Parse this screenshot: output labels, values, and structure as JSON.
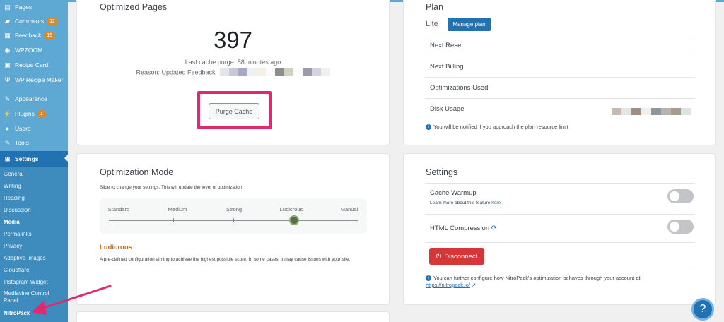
{
  "sidebar": {
    "items": [
      {
        "label": "Pages",
        "icon": "pages-icon",
        "glyph": "▤"
      },
      {
        "label": "Comments",
        "icon": "comments-icon",
        "glyph": "▰",
        "badge": "12"
      },
      {
        "label": "Feedback",
        "icon": "feedback-icon",
        "glyph": "▦",
        "badge": "15"
      },
      {
        "label": "WPZOOM",
        "icon": "wpzoom-icon",
        "glyph": "◉"
      },
      {
        "label": "Recipe Card",
        "icon": "recipe-card-icon",
        "glyph": "▣"
      },
      {
        "label": "WP Recipe Maker",
        "icon": "recipe-maker-icon",
        "glyph": "Ψ"
      },
      {
        "label": "Appearance",
        "icon": "appearance-icon",
        "glyph": "✎"
      },
      {
        "label": "Plugins",
        "icon": "plugins-icon",
        "glyph": "⚡",
        "badge": "1"
      },
      {
        "label": "Users",
        "icon": "users-icon",
        "glyph": "●"
      },
      {
        "label": "Tools",
        "icon": "tools-icon",
        "glyph": "✎"
      },
      {
        "label": "Settings",
        "icon": "settings-icon",
        "glyph": "⊞"
      }
    ],
    "submenu": [
      "General",
      "Writing",
      "Reading",
      "Discussion",
      "Media",
      "Permalinks",
      "Privacy",
      "Adaptive Images",
      "Cloudflare",
      "Instagram Widget",
      "Mediavine Control Panel",
      "NitroPack"
    ]
  },
  "optimized": {
    "title": "Optimized Pages",
    "count": "397",
    "last_purge": "Last cache purge: 58 minutes ago",
    "reason": "Reason: Updated Feedback",
    "purge_button": "Purge Cache"
  },
  "plan": {
    "title": "Plan",
    "tier": "Lite",
    "manage_button": "Manage plan",
    "rows": [
      "Next Reset",
      "Next Billing",
      "Optimizations Used",
      "Disk Usage"
    ],
    "note": "You will be notified if you approach the plan resource limit"
  },
  "mode": {
    "title": "Optimization Mode",
    "description": "Slide to change your settings. This will update the level of optimization.",
    "levels": [
      "Standard",
      "Medium",
      "Strong",
      "Ludicrous",
      "Manual"
    ],
    "selected_level_index": 3,
    "selected": "Ludicrous",
    "selected_description": "A pre-defined configuration aiming to achieve the highest possible score. In some cases, it may cause issues with your site."
  },
  "settings": {
    "title": "Settings",
    "cache_warmup": "Cache Warmup",
    "warmup_help": "Learn more about this feature ",
    "warmup_link": "here",
    "html_compression": "HTML Compression",
    "cache_warmup_enabled": false,
    "html_compression_enabled": false,
    "disconnect": "Disconnect",
    "footer_note": "You can further configure how NitroPack's optimization behaves through your account at",
    "footer_link": "https://nitropack.io/"
  },
  "colors": {
    "accent": "#2271b1",
    "highlight": "#e0296f",
    "danger": "#d63638",
    "mode": "#d4661b"
  }
}
